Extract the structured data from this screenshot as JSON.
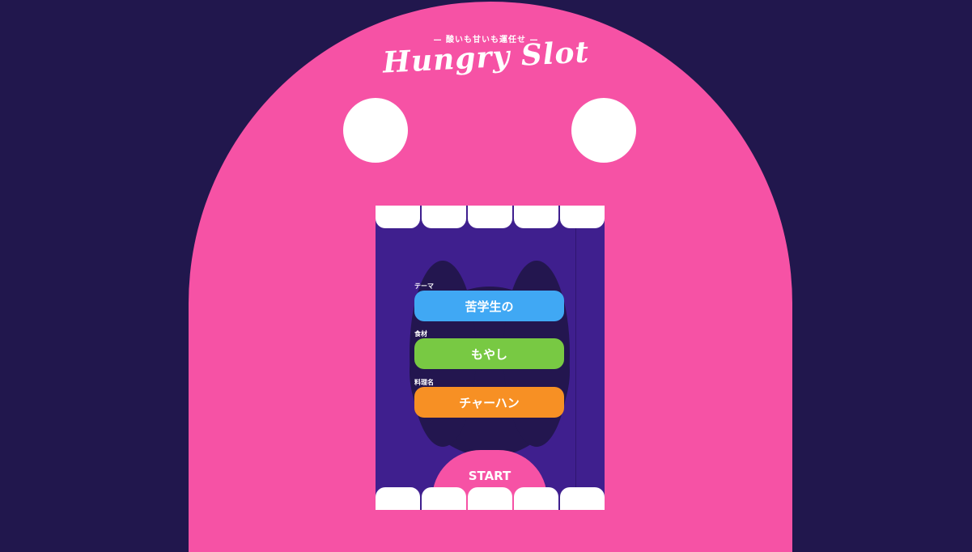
{
  "header": {
    "tagline": "— 酸いも甘いも運任せ —",
    "logo": "Hungry Slot"
  },
  "slots": {
    "theme": {
      "label": "テーマ",
      "value": "苦学生の",
      "color": "#40a8f4"
    },
    "ingredient": {
      "label": "食材",
      "value": "もやし",
      "color": "#78c943"
    },
    "dish": {
      "label": "料理名",
      "value": "チャーハン",
      "color": "#f79024"
    }
  },
  "start_button": {
    "label": "START"
  },
  "colors": {
    "background": "#21174d",
    "monster": "#f652a5",
    "mouth": "#3f1f8e",
    "throat": "#23164f"
  }
}
